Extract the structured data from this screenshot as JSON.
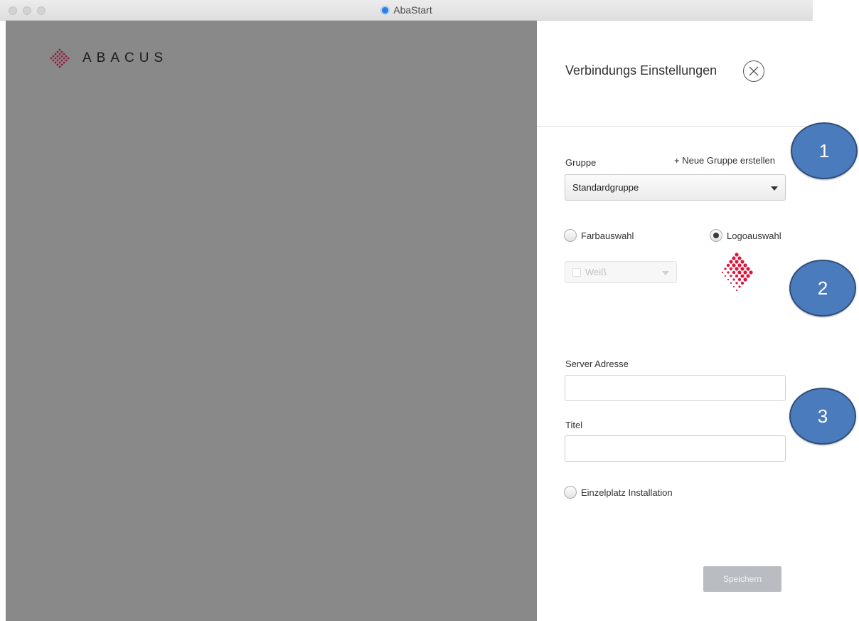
{
  "window": {
    "title": "AbaStart",
    "app_icon": "abastart-icon"
  },
  "brand": {
    "logo_text": "ABACUS",
    "color": "#8b1a3a"
  },
  "panel": {
    "title": "Verbindungs Einstellungen",
    "close_icon": "close-circle-icon",
    "group_label": "Gruppe",
    "new_group_link": "+ Neue Gruppe erstellen",
    "group_selected": "Standardgruppe",
    "color_radio_label": "Farbauswahl",
    "logo_radio_label": "Logoauswahl",
    "color_selected": "Weiß",
    "logo_color": "#e0143c",
    "server_label": "Server Adresse",
    "server_value": "",
    "title_label": "Titel",
    "title_value": "",
    "single_install_label": "Einzelplatz Installation",
    "save_label": "Speichern"
  },
  "callouts": [
    "1",
    "2",
    "3"
  ],
  "colors": {
    "left_pane": "#898989",
    "callout_fill": "#4a7bbd",
    "save_disabled": "#b9bdc2"
  }
}
